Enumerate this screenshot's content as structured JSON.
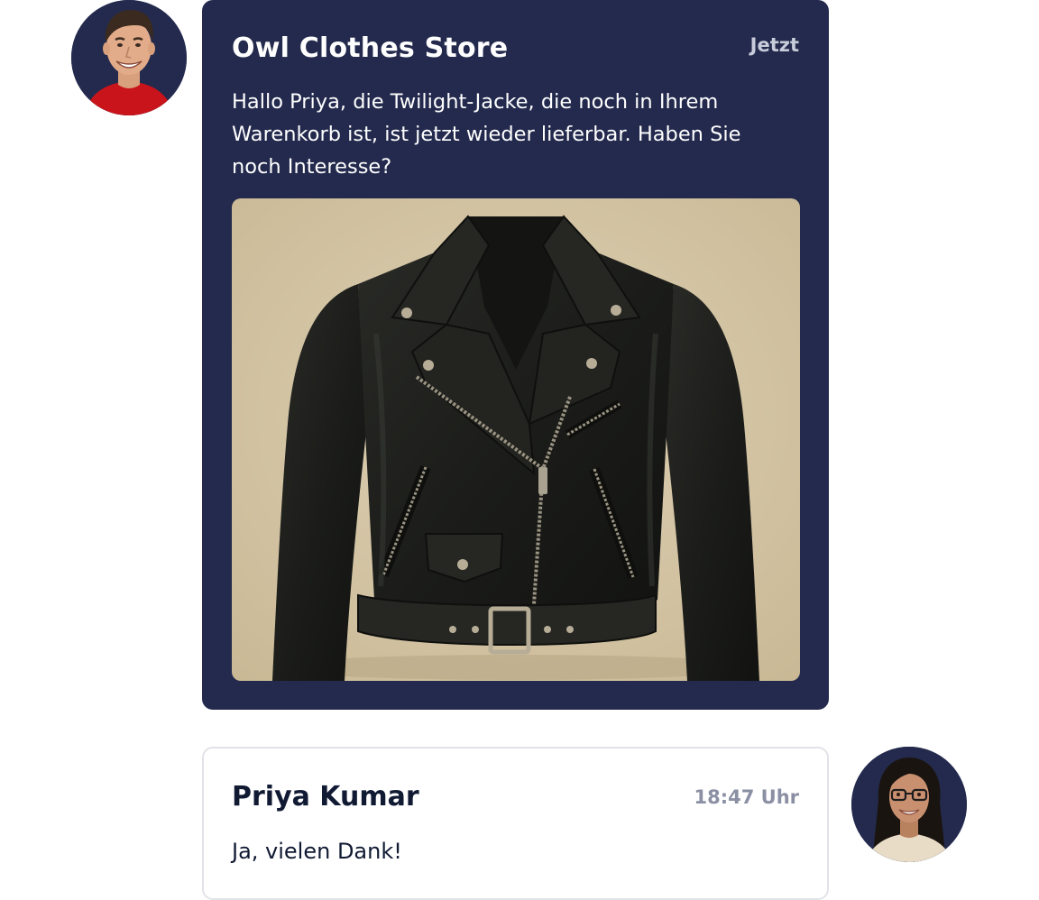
{
  "conversation": {
    "incoming": {
      "sender": "Owl Clothes Store",
      "time": "Jetzt",
      "message": "Hallo Priya, die Twilight-Jacke, die noch in Ihrem Warenkorb ist, ist jetzt wieder lieferbar. Haben Sie noch Interesse?",
      "image": "black-leather-biker-jacket-photo",
      "avatar": "store-agent-avatar"
    },
    "outgoing": {
      "sender": "Priya Kumar",
      "time": "18:47 Uhr",
      "message": "Ja, vielen Dank!",
      "avatar": "customer-avatar"
    }
  },
  "colors": {
    "bubble_dark": "#232a4d",
    "bubble_light_border": "#e2e3e8",
    "text_dark": "#111a33",
    "text_muted": "#8b8fa3",
    "image_background": "#d6c8ad",
    "jacket": "#1d1e1b"
  }
}
